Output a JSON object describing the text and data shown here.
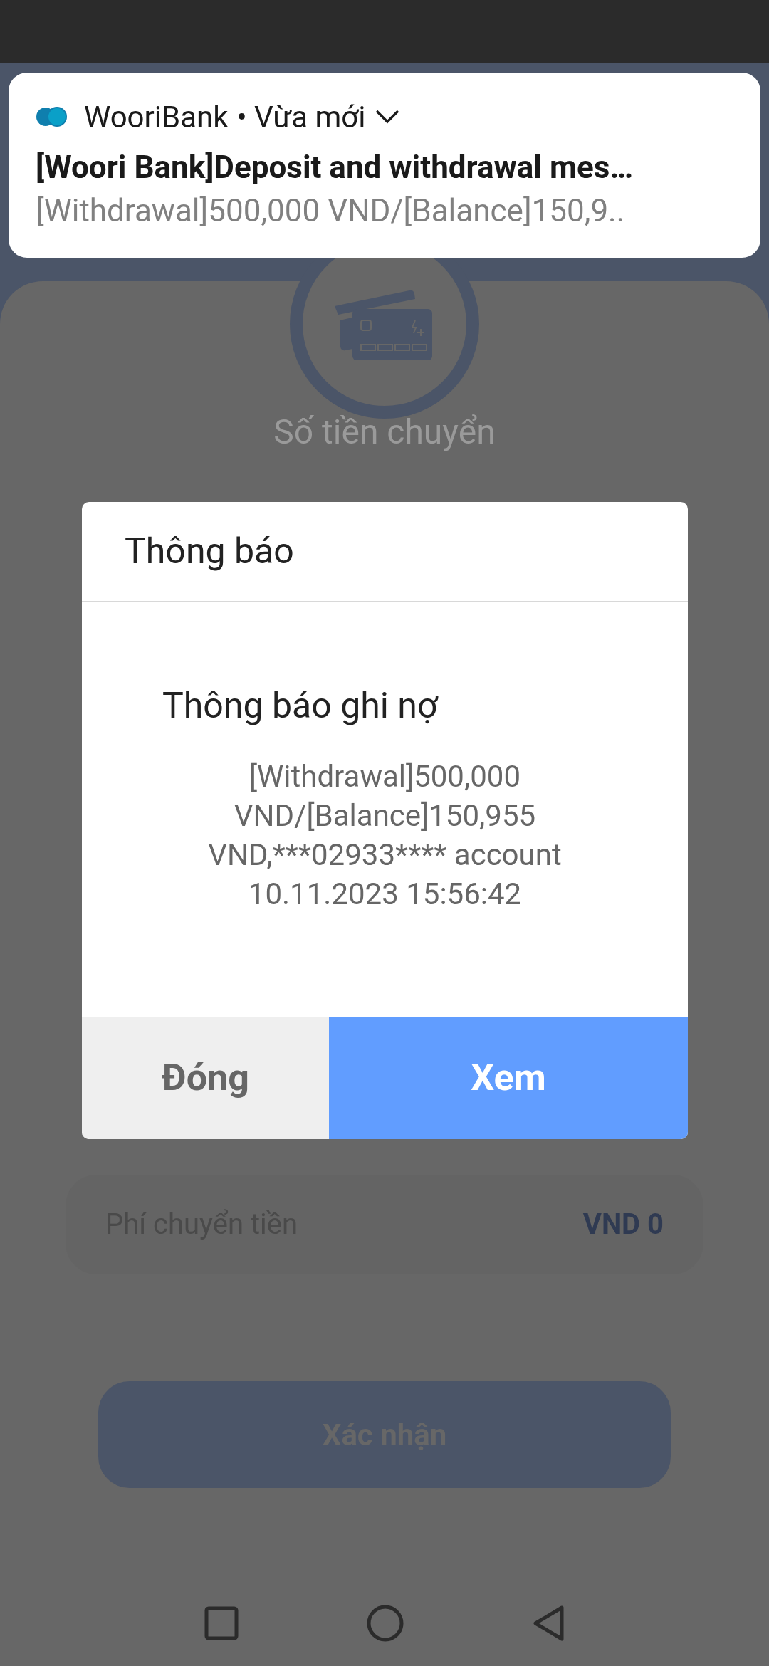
{
  "notification": {
    "app_name": "WooriBank",
    "time": "• Vừa mới",
    "title": "[Woori Bank]Deposit and withdrawal mes…",
    "body": "[Withdrawal]500,000 VND/[Balance]150,9.."
  },
  "transfer": {
    "amount_label": "Số tiền chuyển",
    "fee_label": "Phí chuyển tiền",
    "fee_value": "VND 0",
    "confirm_button": "Xác nhận"
  },
  "dialog": {
    "title": "Thông báo",
    "heading": "Thông báo ghi nợ",
    "message_lines": [
      "[Withdrawal]500,000",
      "VND/[Balance]150,955",
      "VND,***02933**** account",
      "10.11.2023 15:56:42"
    ],
    "buttons": [
      {
        "label": "Đóng",
        "kind": "secondary"
      },
      {
        "label": "Xem",
        "kind": "primary"
      }
    ]
  }
}
